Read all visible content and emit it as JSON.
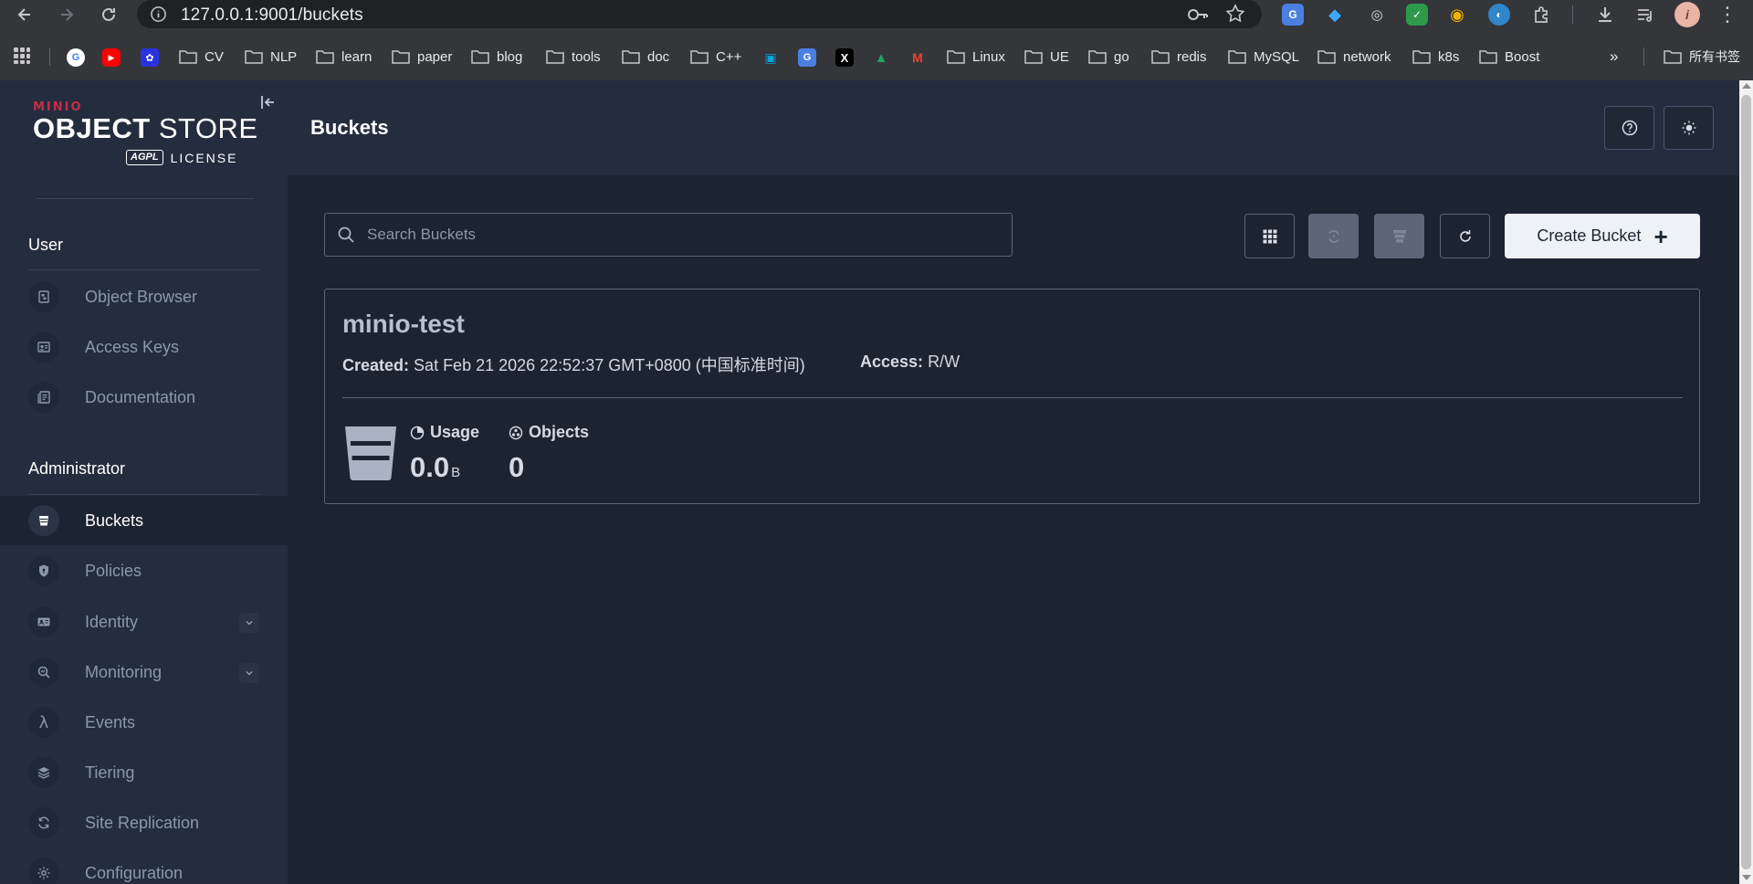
{
  "browser": {
    "url": "127.0.0.1:9001/buckets",
    "bookmarks": {
      "cv": "CV",
      "nlp": "NLP",
      "learn": "learn",
      "paper": "paper",
      "blog": "blog",
      "tools": "tools",
      "doc": "doc",
      "cpp": "C++",
      "linux": "Linux",
      "ue": "UE",
      "go": "go",
      "redis": "redis",
      "mysql": "MySQL",
      "network": "network",
      "k8s": "k8s",
      "boost": "Boost",
      "all": "所有书签"
    }
  },
  "logo": {
    "brand": "MINIO",
    "product_bold": "OBJECT",
    "product_rest": " STORE",
    "agpl": "AGPL",
    "license": "LICENSE"
  },
  "sidebar": {
    "user_section": "User",
    "user_items": [
      "Object Browser",
      "Access Keys",
      "Documentation"
    ],
    "admin_section": "Administrator",
    "admin_items": [
      "Buckets",
      "Policies",
      "Identity",
      "Monitoring",
      "Events",
      "Tiering",
      "Site Replication",
      "Configuration"
    ],
    "active_item": "Buckets"
  },
  "header": {
    "title": "Buckets"
  },
  "toolbar": {
    "search_placeholder": "Search Buckets",
    "create_label": "Create Bucket",
    "create_icon": "plus-icon"
  },
  "bucket": {
    "name": "minio-test",
    "created_label": "Created:",
    "created_value": "Sat Feb 21 2026 22:52:37 GMT+0800 (中国标准时间)",
    "access_label": "Access:",
    "access_value": "R/W",
    "usage_label": "Usage",
    "usage_value": "0.0",
    "usage_unit": "B",
    "objects_label": "Objects",
    "objects_value": "0"
  },
  "colors": {
    "sidebar_bg": "#232d3d",
    "main_bg": "#1c2431",
    "brand_red": "#c72c48",
    "button_light": "#eef1f5"
  }
}
